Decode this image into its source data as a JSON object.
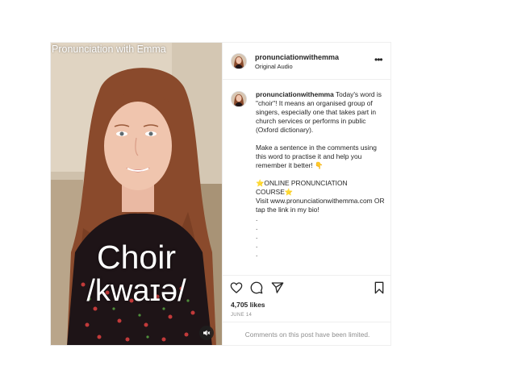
{
  "video": {
    "brand_text": "Pronunciation with Emma",
    "word": "Choir",
    "ipa": "/kwaɪə/",
    "mute_icon": "speaker-muted-icon"
  },
  "header": {
    "username": "pronunciationwithemma",
    "audio": "Original Audio",
    "more_icon": "more-horizontal-icon"
  },
  "caption": {
    "username": "pronunciationwithemma",
    "body": " Today's word is \"choir\"! It means an organised group of singers, especially one that takes part in church services or performs in public (Oxford dictionary).\n\nMake a sentence in the comments using this word to practise it and help you remember it better! 👇\n\n⭐ONLINE PRONUNCIATION COURSE⭐\nVisit www.pronunciationwithemma.com OR tap the link in my bio!\n.\n.\n.\n.\n."
  },
  "actions": {
    "like_icon": "heart-icon",
    "comment_icon": "comment-bubble-icon",
    "share_icon": "paper-plane-icon",
    "save_icon": "bookmark-icon",
    "likes": "4,705 likes",
    "date": "JUNE 14"
  },
  "comments": {
    "limited_text": "Comments on this post have been limited."
  },
  "colors": {
    "text": "#262626",
    "muted": "#8e8e8e",
    "border": "#efefef"
  }
}
